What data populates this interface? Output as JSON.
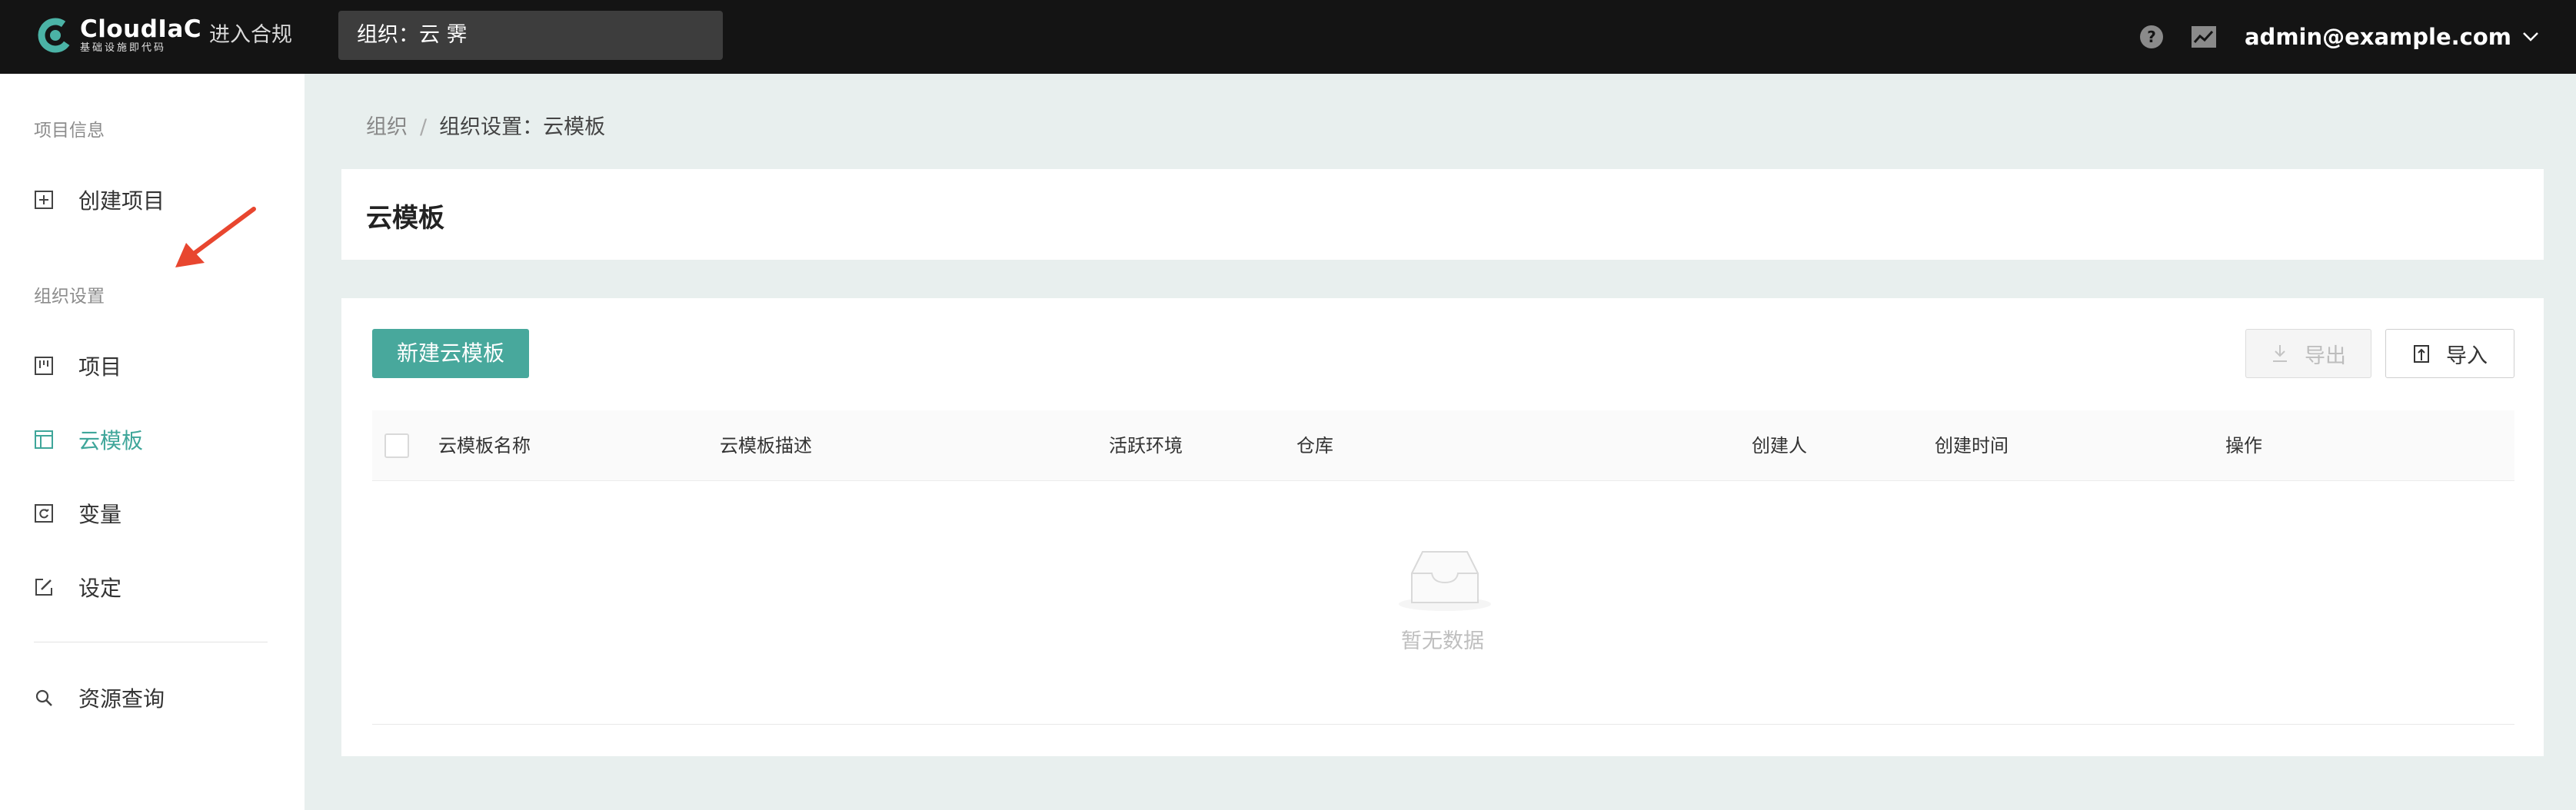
{
  "header": {
    "logo_name": "CloudIaC",
    "logo_sub": "基础设施即代码",
    "compliance_link": "进入合规",
    "org_selector": "组织：云 霁",
    "user_email": "admin@example.com"
  },
  "sidebar": {
    "group_project": "项目信息",
    "create_project": "创建项目",
    "group_org": "组织设置",
    "items": [
      {
        "label": "项目",
        "icon": "project-board-icon"
      },
      {
        "label": "云模板",
        "icon": "template-icon"
      },
      {
        "label": "变量",
        "icon": "variable-icon"
      },
      {
        "label": "设定",
        "icon": "edit-icon"
      }
    ],
    "resource_search": "资源查询"
  },
  "breadcrumb": {
    "root": "组织",
    "separator": "/",
    "current": "组织设置：云模板"
  },
  "page": {
    "title": "云模板",
    "new_button": "新建云模板",
    "export_button": "导出",
    "import_button": "导入",
    "columns": [
      "云模板名称",
      "云模板描述",
      "活跃环境",
      "仓库",
      "创建人",
      "创建时间",
      "操作"
    ],
    "empty_text": "暂无数据"
  },
  "colors": {
    "accent": "#48a89c",
    "topbar": "#141414",
    "arrow": "#e8462f"
  }
}
